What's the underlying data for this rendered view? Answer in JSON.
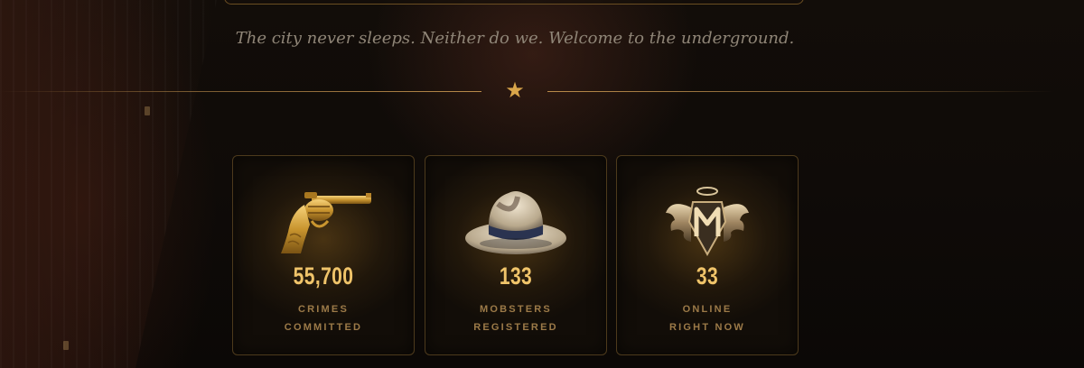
{
  "tagline": "The city never sleeps. Neither do we. Welcome to the underground.",
  "divider": {
    "icon": "star-icon"
  },
  "stats": [
    {
      "icon": "revolver-icon",
      "value": "55,700",
      "label_line1": "CRIMES",
      "label_line2": "COMMITTED"
    },
    {
      "icon": "fedora-hat-icon",
      "value": "133",
      "label_line1": "MOBSTERS",
      "label_line2": "REGISTERED"
    },
    {
      "icon": "winged-m-emblem-icon",
      "value": "33",
      "label_line1": "ONLINE",
      "label_line2": "RIGHT NOW"
    }
  ],
  "colors": {
    "accent": "#d9a54a",
    "value": "#f0c46a",
    "label": "#9c7a48",
    "tagline": "#8f8577"
  }
}
